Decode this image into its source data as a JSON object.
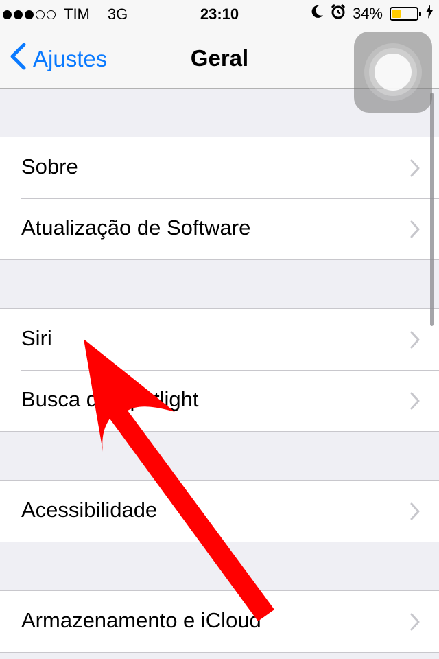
{
  "status_bar": {
    "carrier": "TIM",
    "network": "3G",
    "time": "23:10",
    "battery_percent": "34%",
    "signal_bars": 3,
    "signal_total": 5,
    "battery_level": 0.34,
    "battery_color": "#ffcc00",
    "icons": [
      "moon-icon",
      "alarm-icon",
      "charging-bolt-icon"
    ]
  },
  "navbar": {
    "back_label": "Ajustes",
    "title": "Geral",
    "accent_color": "#0a7aff"
  },
  "sections": [
    {
      "items": [
        {
          "label": "Sobre"
        },
        {
          "label": "Atualização de Software"
        }
      ]
    },
    {
      "items": [
        {
          "label": "Siri"
        },
        {
          "label": "Busca do Spotlight"
        }
      ]
    },
    {
      "items": [
        {
          "label": "Acessibilidade"
        }
      ]
    },
    {
      "items": [
        {
          "label": "Armazenamento e iCloud"
        }
      ]
    }
  ],
  "annotation": {
    "shape": "red-arrow-icon",
    "color": "#ff0000",
    "points_to": "Siri"
  }
}
